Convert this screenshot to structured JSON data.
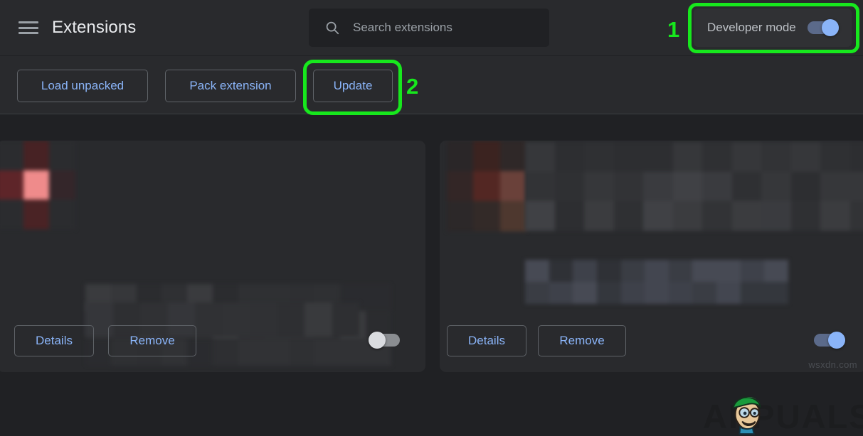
{
  "header": {
    "menu_icon": "hamburger-menu-icon",
    "title": "Extensions",
    "search": {
      "icon": "search-icon",
      "placeholder": "Search extensions",
      "value": ""
    },
    "developer_mode": {
      "label": "Developer mode",
      "toggle_state": "on"
    }
  },
  "toolbar": {
    "load_unpacked_label": "Load unpacked",
    "pack_extension_label": "Pack extension",
    "update_label": "Update"
  },
  "extensions": [
    {
      "name": "",
      "description": "",
      "details_label": "Details",
      "remove_label": "Remove",
      "enabled_toggle_state": "off",
      "icon_name": "extension-icon-blurred",
      "content_blurred": true
    },
    {
      "name": "",
      "description": "",
      "details_label": "Details",
      "remove_label": "Remove",
      "enabled_toggle_state": "on",
      "icon_name": "extension-icon-blurred",
      "content_blurred": true
    }
  ],
  "annotations": [
    {
      "number": "1",
      "target": "developer-mode-toggle"
    },
    {
      "number": "2",
      "target": "update-button"
    }
  ],
  "watermark": {
    "text": "APPUALS",
    "site_tag": "wsxdn.com"
  },
  "colors": {
    "page_background": "#202124",
    "surface": "#292a2d",
    "accent_link": "#8ab4f8",
    "toggle_on": "#8ab4f8",
    "toggle_off": "#dadce0",
    "annotation_green": "#17e81d",
    "text_primary": "#e8eaed",
    "text_secondary": "#9aa0a6",
    "border": "#5f6368"
  }
}
